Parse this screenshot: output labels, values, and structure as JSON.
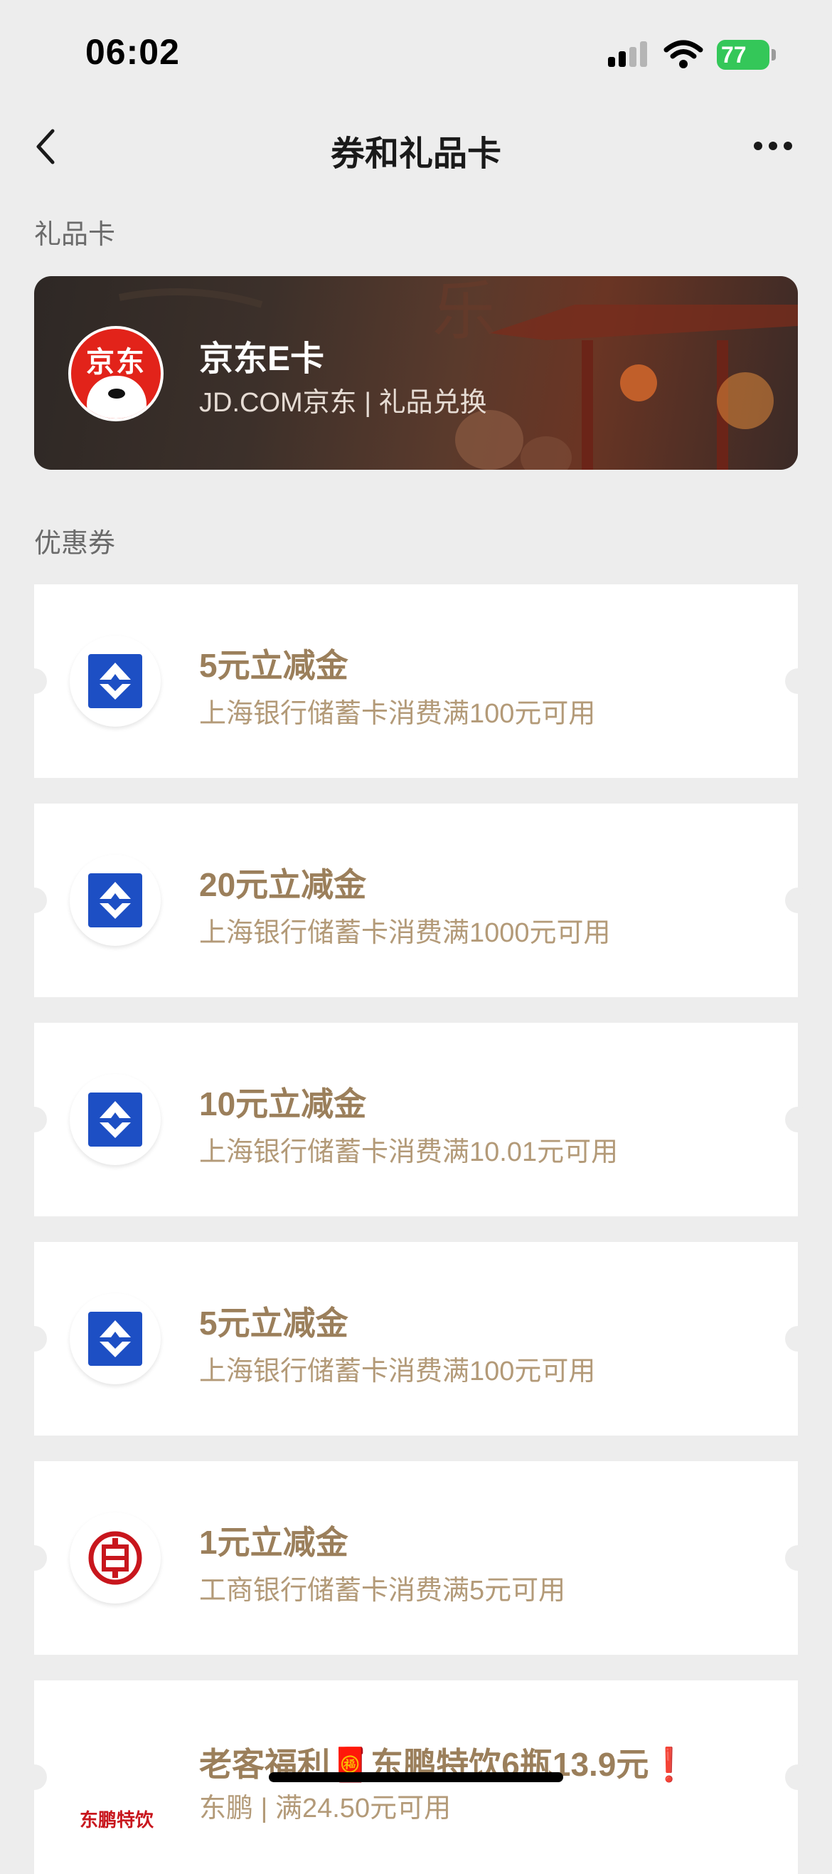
{
  "status_bar": {
    "time": "06:02",
    "battery": "77"
  },
  "nav": {
    "title": "券和礼品卡",
    "back_icon": "chevron-left-icon",
    "more_icon": "more-dots-icon"
  },
  "gift_section": {
    "label": "礼品卡",
    "card": {
      "name": "京东E卡",
      "subtitle": "JD.COM京东 | 礼品兑换",
      "logo_text": "京东"
    }
  },
  "coupon_section": {
    "label": "优惠券",
    "coupons": [
      {
        "title": "5元立减金",
        "desc": "上海银行储蓄卡消费满100元可用",
        "logo": "bank-of-shanghai-icon"
      },
      {
        "title": "20元立减金",
        "desc": "上海银行储蓄卡消费满1000元可用",
        "logo": "bank-of-shanghai-icon"
      },
      {
        "title": "10元立减金",
        "desc": "上海银行储蓄卡消费满10.01元可用",
        "logo": "bank-of-shanghai-icon"
      },
      {
        "title": "5元立减金",
        "desc": "上海银行储蓄卡消费满100元可用",
        "logo": "bank-of-shanghai-icon"
      },
      {
        "title": "1元立减金",
        "desc": "工商银行储蓄卡消费满5元可用",
        "logo": "icbc-icon"
      },
      {
        "title": "老客福利🧧东鹏特饮6瓶13.9元❗",
        "desc": "东鹏 | 满24.50元可用",
        "logo": "dongpeng-icon",
        "logo_text": "东鹏特饮"
      }
    ]
  },
  "colors": {
    "background": "#ededed",
    "coupon_title": "#9b7f5b",
    "coupon_desc": "#b39a78",
    "battery": "#34c759"
  }
}
